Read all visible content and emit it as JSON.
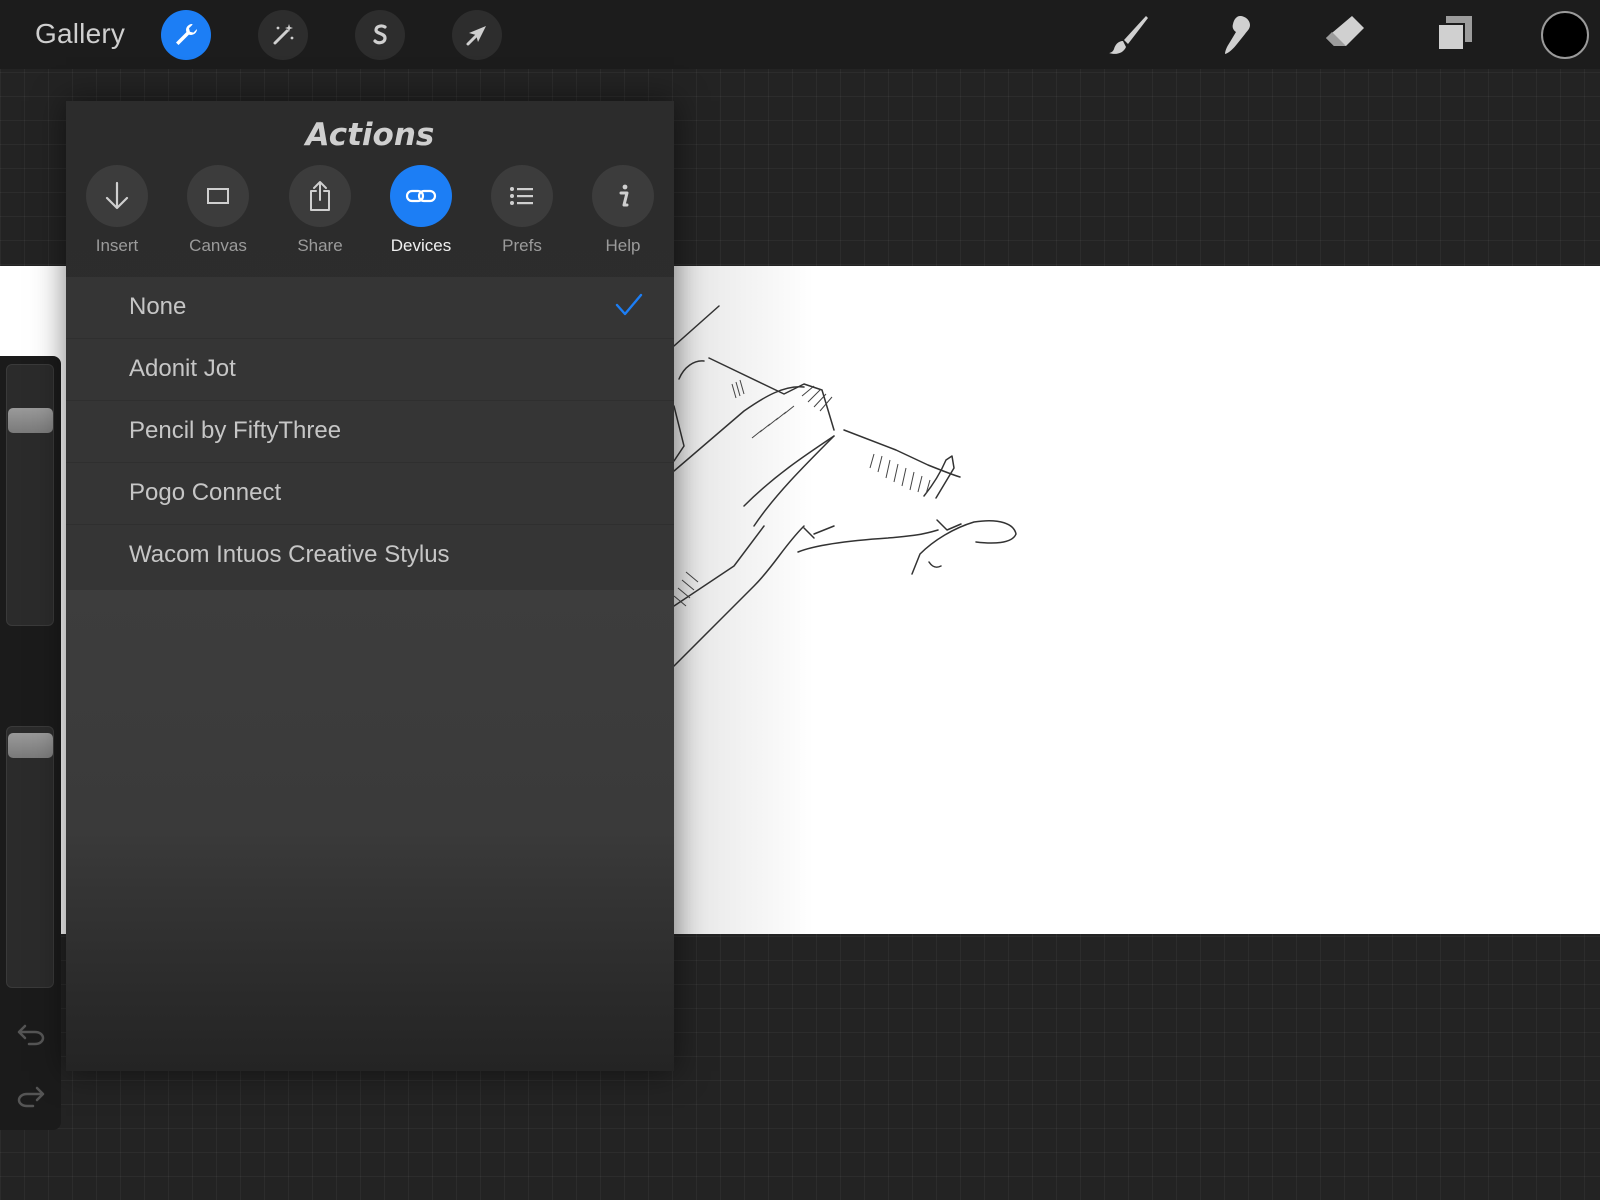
{
  "topbar": {
    "gallery_label": "Gallery",
    "left_tools": [
      {
        "name": "actions-wrench-icon",
        "active": true
      },
      {
        "name": "adjustments-wand-icon",
        "active": false
      },
      {
        "name": "selection-s-icon",
        "active": false
      },
      {
        "name": "transform-arrow-icon",
        "active": false
      }
    ],
    "right_tools": [
      "brush-icon",
      "smudge-icon",
      "eraser-icon",
      "layers-icon"
    ],
    "current_color": "#000000",
    "accent_color": "#1c7ef5"
  },
  "actions_panel": {
    "title": "Actions",
    "tabs": [
      {
        "label": "Insert",
        "icon": "insert-arrow-down-icon",
        "active": false
      },
      {
        "label": "Canvas",
        "icon": "canvas-rectangle-icon",
        "active": false
      },
      {
        "label": "Share",
        "icon": "share-icon",
        "active": false
      },
      {
        "label": "Devices",
        "icon": "devices-link-icon",
        "active": true
      },
      {
        "label": "Prefs",
        "icon": "prefs-list-icon",
        "active": false
      },
      {
        "label": "Help",
        "icon": "help-info-icon",
        "active": false
      }
    ],
    "devices": [
      {
        "label": "None",
        "selected": true
      },
      {
        "label": "Adonit Jot",
        "selected": false
      },
      {
        "label": "Pencil by FiftyThree",
        "selected": false
      },
      {
        "label": "Pogo Connect",
        "selected": false
      },
      {
        "label": "Wacom Intuos Creative Stylus",
        "selected": false
      }
    ]
  },
  "sidebar": {
    "brush_size_level": 0.18,
    "opacity_level": 0.98,
    "undo_icon": "undo-icon",
    "redo_icon": "redo-icon"
  }
}
